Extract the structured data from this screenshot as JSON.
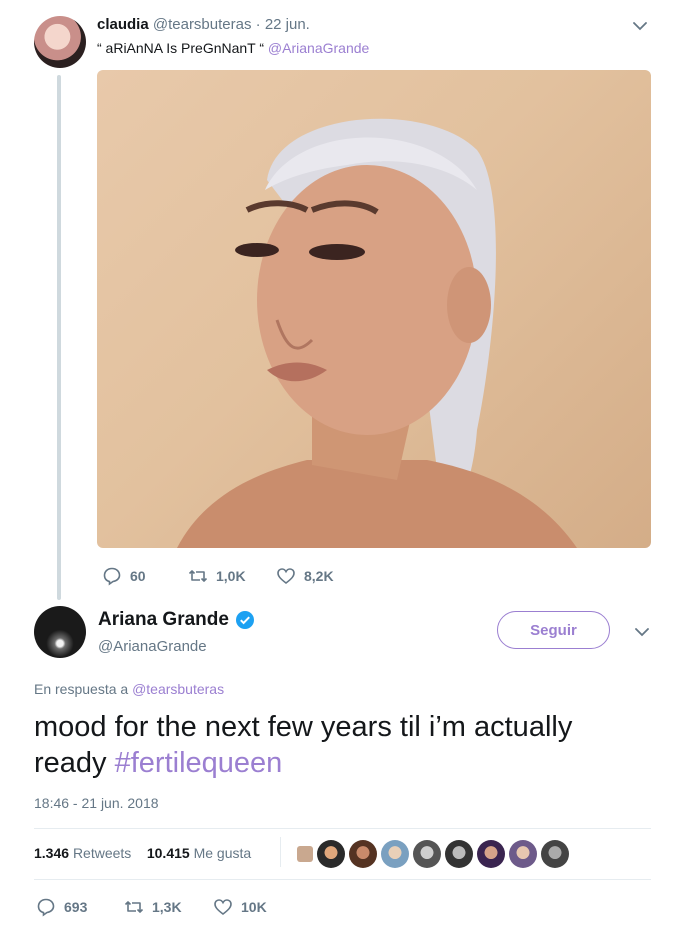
{
  "reply_tweet": {
    "display_name": "claudia",
    "handle": "@tearsbuteras",
    "separator": "·",
    "date": "22 jun.",
    "text_quote": "“ aRiAnNA Is PreGnNanT “",
    "mention": "@ArianaGrande",
    "actions": {
      "replies": "60",
      "retweets": "1,0K",
      "likes": "8,2K"
    }
  },
  "main_tweet": {
    "display_name": "Ariana Grande",
    "handle": "@ArianaGrande",
    "follow_label": "Seguir",
    "reply_context_prefix": "En respuesta a",
    "reply_context_handle": "@tearsbuteras",
    "text": "mood for the next few years til i’m actually ready",
    "hashtag": "#fertilequeen",
    "timestamp": "18:46 - 21 jun. 2018",
    "stats": {
      "retweets_count": "1.346",
      "retweets_label": "Retweets",
      "likes_count": "10.415",
      "likes_label": "Me gusta"
    },
    "actions": {
      "replies": "693",
      "retweets": "1,3K",
      "likes": "10K"
    }
  },
  "icons": {
    "chevron": "chevron-down-icon",
    "reply": "reply-icon",
    "retweet": "retweet-icon",
    "like": "heart-icon",
    "verified": "verified-badge-icon"
  },
  "colors": {
    "accent": "#9b7fd1",
    "muted": "#657786",
    "verified": "#1da1f2",
    "photo_bg": "#e4c7a8"
  }
}
